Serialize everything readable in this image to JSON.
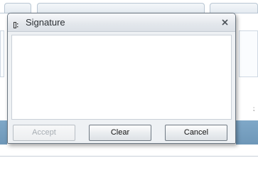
{
  "dialog": {
    "title": "Signature",
    "close_glyph": "×",
    "icon": "signature-icon"
  },
  "buttons": {
    "accept": {
      "label": "Accept",
      "enabled": false
    },
    "clear": {
      "label": "Clear",
      "enabled": true
    },
    "cancel": {
      "label": "Cancel",
      "enabled": true
    }
  },
  "background": {
    "mark": ";"
  },
  "colors": {
    "bar_accent": "#7fa8c8",
    "dialog_bg": "#eef1f4",
    "border": "#6b7782"
  }
}
